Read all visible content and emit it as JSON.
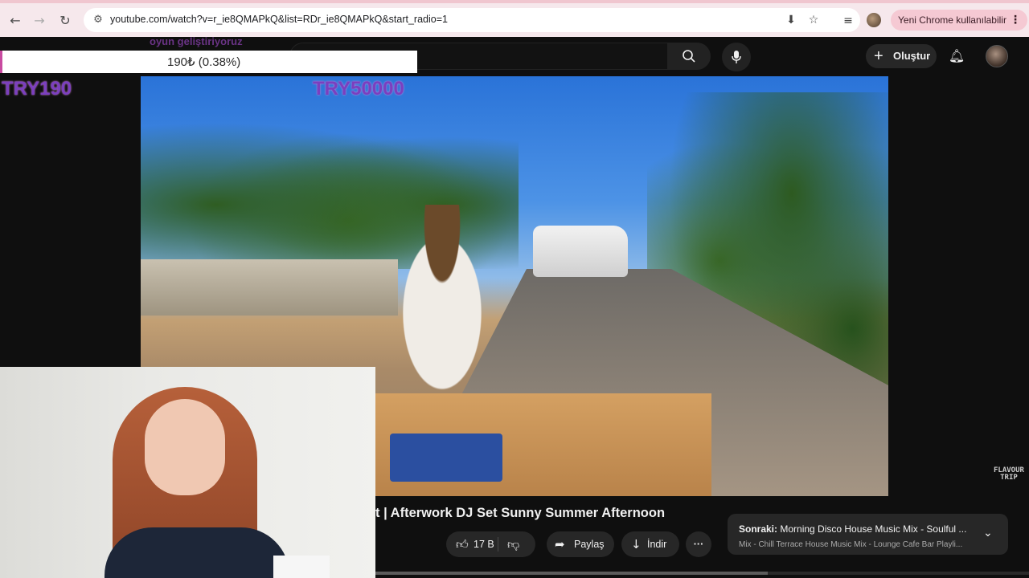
{
  "browser": {
    "url": "youtube.com/watch?v=r_ie8QMAPkQ&list=RDr_ie8QMAPkQ&start_radio=1",
    "update_label": "Yeni Chrome kullanılabilir",
    "accent": "#f5c9d3"
  },
  "youtube": {
    "header": {
      "create_label": "Oluştur"
    },
    "video": {
      "title": "t | Afterwork DJ Set Sunny Summer Afternoon",
      "watermark": "FLAVOUR\nTRIP"
    },
    "actions": {
      "likes": "17 B",
      "share_label": "Paylaş",
      "download_label": "İndir"
    },
    "up_next": {
      "prefix": "Sonraki:",
      "title": "Morning Disco House Music Mix - Soulful ...",
      "subtitle": "Mix - Chill Terrace House Music Mix - Lounge Cafe Bar Playli..."
    }
  },
  "overlay": {
    "ghost_text": "oyun geliştiriyoruz",
    "progress_text": "190₺ (0.38%)",
    "progress_fraction": 0.0038,
    "goal_current": "TRY190",
    "goal_target": "TRY50000"
  },
  "icons": [
    "back-icon",
    "forward-icon",
    "reload-icon",
    "tune-icon",
    "install-icon",
    "star-icon",
    "media-icon",
    "profile-icon",
    "menu-dots-icon",
    "search-icon",
    "mic-icon",
    "plus-icon",
    "bell-icon",
    "like-icon",
    "dislike-icon",
    "share-icon",
    "download-icon",
    "more-icon",
    "chevron-down-icon"
  ]
}
